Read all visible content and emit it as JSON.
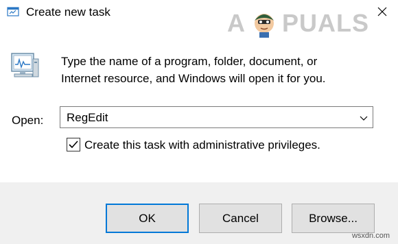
{
  "window": {
    "title": "Create new task",
    "icon": "run-icon",
    "close_icon": "close-icon"
  },
  "watermark": {
    "text_left": "A",
    "text_right": "PUALS"
  },
  "description": {
    "line1": "Type the name of a program, folder, document, or",
    "line2": "Internet resource, and Windows will open it for you."
  },
  "open_field": {
    "label": "Open:",
    "value": "RegEdit"
  },
  "admin_checkbox": {
    "label": "Create this task with administrative privileges.",
    "checked": true
  },
  "buttons": {
    "ok": "OK",
    "cancel": "Cancel",
    "browse": "Browse..."
  },
  "credit": "wsxdn.com",
  "colors": {
    "accent": "#0078d7",
    "footer_bg": "#f0f0f0",
    "button_bg": "#e1e1e1"
  }
}
